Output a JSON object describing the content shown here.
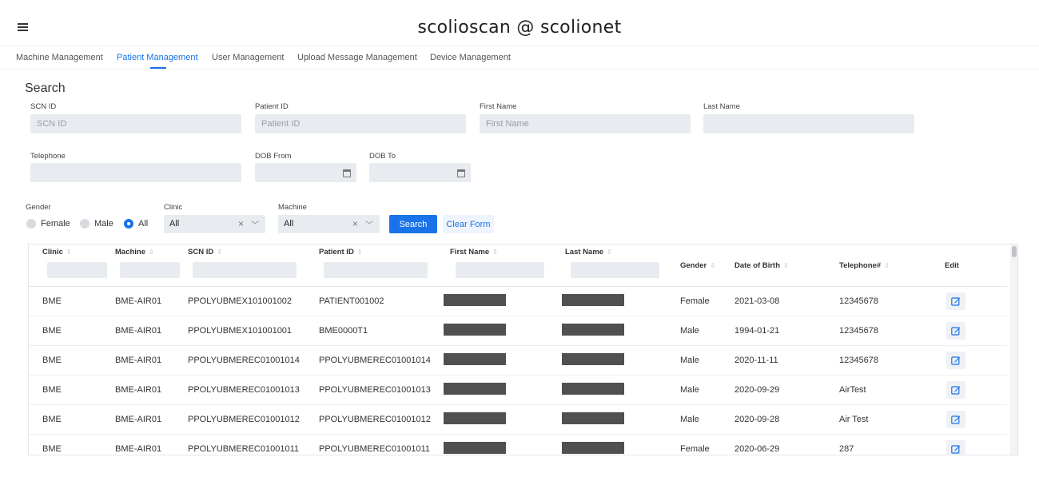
{
  "app": {
    "title": "scolioscan @ scolionet"
  },
  "nav": [
    {
      "label": "Machine Management",
      "active": false
    },
    {
      "label": "Patient Management",
      "active": true
    },
    {
      "label": "User Management",
      "active": false
    },
    {
      "label": "Upload Message Management",
      "active": false
    },
    {
      "label": "Device Management",
      "active": false
    }
  ],
  "search": {
    "title": "Search",
    "scn_id": {
      "label": "SCN ID",
      "placeholder": "SCN ID",
      "value": ""
    },
    "patient_id": {
      "label": "Patient ID",
      "placeholder": "Patient ID",
      "value": ""
    },
    "first_name": {
      "label": "First Name",
      "placeholder": "First Name",
      "value": ""
    },
    "last_name": {
      "label": "Last Name",
      "placeholder": "",
      "value": ""
    },
    "telephone": {
      "label": "Telephone",
      "placeholder": "",
      "value": ""
    },
    "dob_from": {
      "label": "DOB From",
      "value": ""
    },
    "dob_to": {
      "label": "DOB To",
      "value": ""
    },
    "gender": {
      "label": "Gender",
      "options": [
        "Female",
        "Male",
        "All"
      ],
      "selected": "All"
    },
    "clinic": {
      "label": "Clinic",
      "value": "All"
    },
    "machine": {
      "label": "Machine",
      "value": "All"
    },
    "search_button": "Search",
    "clear_button": "Clear Form"
  },
  "table": {
    "columns": [
      "Clinic",
      "Machine",
      "SCN ID",
      "Patient ID",
      "First Name",
      "Last Name",
      "Gender",
      "Date of Birth",
      "Telephone#",
      "Edit"
    ],
    "rows": [
      {
        "clinic": "BME",
        "machine": "BME-AIR01",
        "scn_id": "PPOLYUBMEX101001002",
        "patient_id": "PATIENT001002",
        "gender": "Female",
        "dob": "2021-03-08",
        "telephone": "12345678"
      },
      {
        "clinic": "BME",
        "machine": "BME-AIR01",
        "scn_id": "PPOLYUBMEX101001001",
        "patient_id": "BME0000T1",
        "gender": "Male",
        "dob": "1994-01-21",
        "telephone": "12345678"
      },
      {
        "clinic": "BME",
        "machine": "BME-AIR01",
        "scn_id": "PPOLYUBMEREC01001014",
        "patient_id": "PPOLYUBMEREC01001014",
        "gender": "Male",
        "dob": "2020-11-11",
        "telephone": "12345678"
      },
      {
        "clinic": "BME",
        "machine": "BME-AIR01",
        "scn_id": "PPOLYUBMEREC01001013",
        "patient_id": "PPOLYUBMEREC01001013",
        "gender": "Male",
        "dob": "2020-09-29",
        "telephone": "AirTest"
      },
      {
        "clinic": "BME",
        "machine": "BME-AIR01",
        "scn_id": "PPOLYUBMEREC01001012",
        "patient_id": "PPOLYUBMEREC01001012",
        "gender": "Male",
        "dob": "2020-09-28",
        "telephone": "Air Test"
      },
      {
        "clinic": "BME",
        "machine": "BME-AIR01",
        "scn_id": "PPOLYUBMEREC01001011",
        "patient_id": "PPOLYUBMEREC01001011",
        "gender": "Female",
        "dob": "2020-06-29",
        "telephone": "287"
      }
    ]
  },
  "colors": {
    "accent": "#1a73e8",
    "input_bg": "#e8ebef",
    "redaction": "#505050"
  }
}
